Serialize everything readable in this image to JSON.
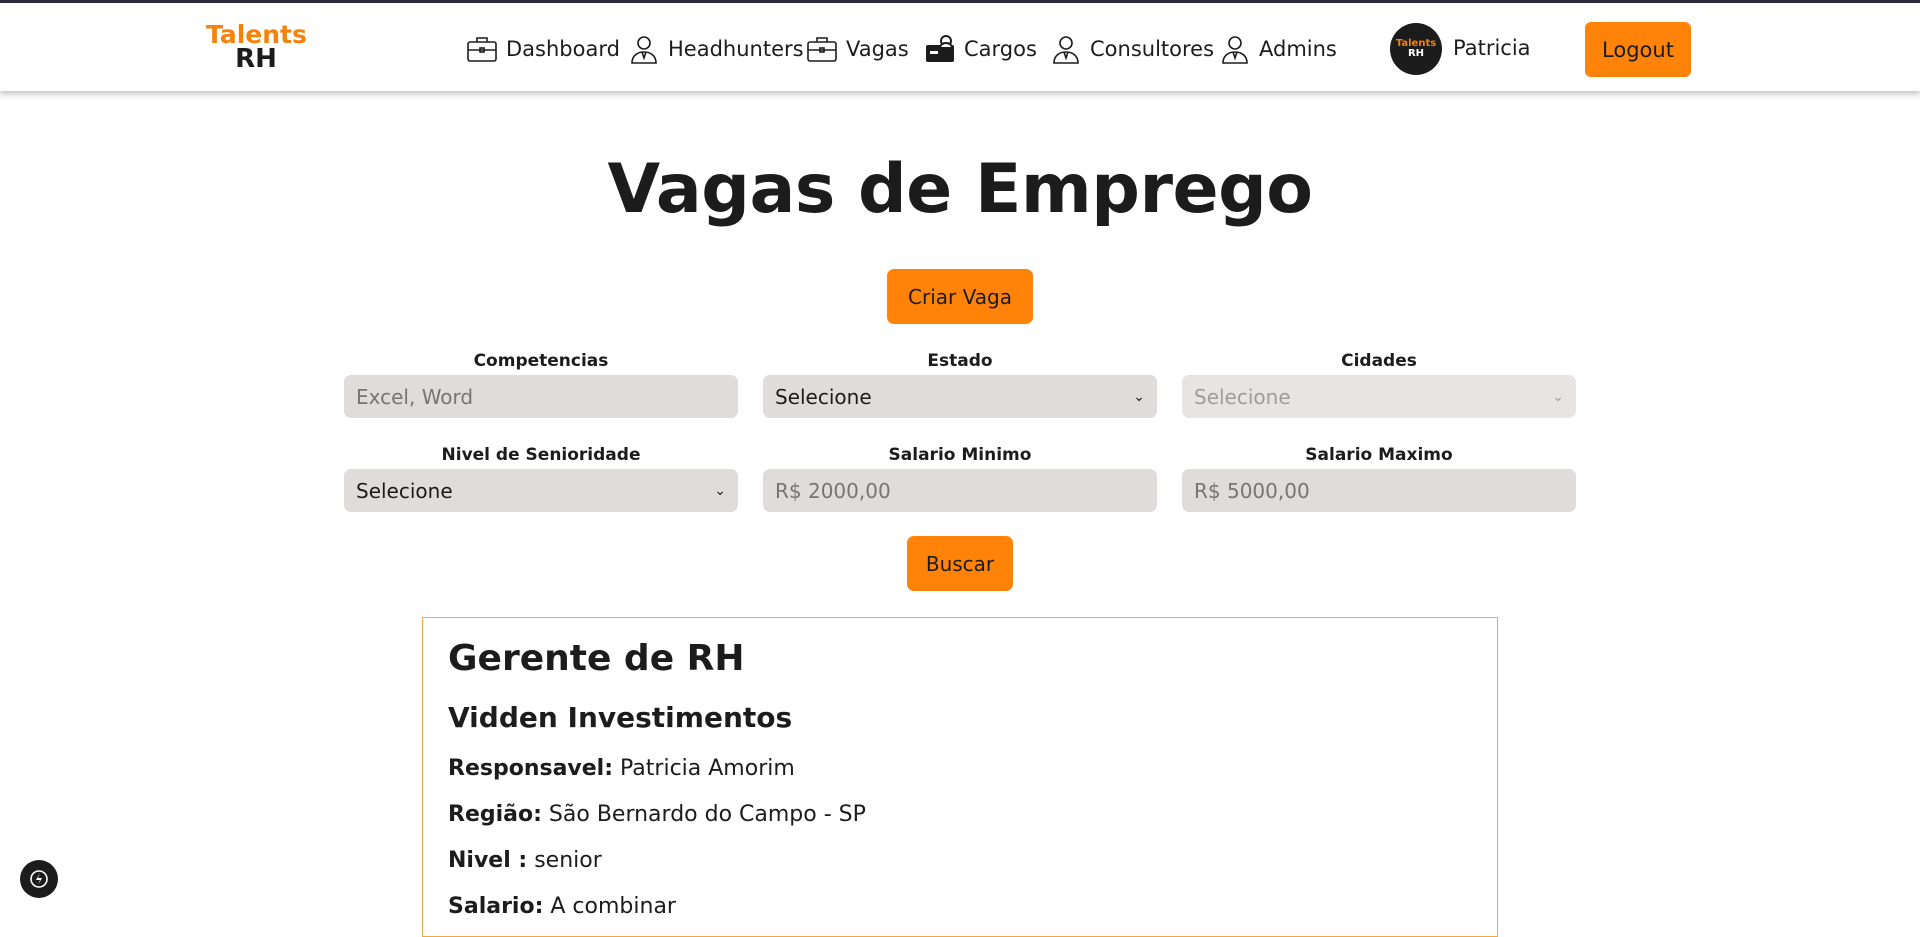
{
  "brand": {
    "logo_line1": "Talents",
    "logo_line2": "RH",
    "avatar_line1": "Talents",
    "avatar_line2": "RH"
  },
  "nav": {
    "items": [
      {
        "label": "Dashboard",
        "icon": "briefcase-icon"
      },
      {
        "label": "Headhunters",
        "icon": "person-icon"
      },
      {
        "label": "Vagas",
        "icon": "briefcase-icon"
      },
      {
        "label": "Cargos",
        "icon": "briefcase-user-icon"
      },
      {
        "label": "Consultores",
        "icon": "person-icon"
      },
      {
        "label": "Admins",
        "icon": "person-icon"
      }
    ],
    "user_name": "Patricia",
    "logout_label": "Logout"
  },
  "page": {
    "title": "Vagas de Emprego",
    "create_label": "Criar Vaga",
    "search_label": "Buscar"
  },
  "filters": {
    "competencias": {
      "label": "Competencias",
      "placeholder": "Excel, Word"
    },
    "estado": {
      "label": "Estado",
      "value": "Selecione"
    },
    "cidades": {
      "label": "Cidades",
      "value": "Selecione"
    },
    "nivel": {
      "label": "Nivel de Senioridade",
      "value": "Selecione"
    },
    "salario_min": {
      "label": "Salario Minimo",
      "placeholder": "R$ 2000,00"
    },
    "salario_max": {
      "label": "Salario Maximo",
      "placeholder": "R$ 5000,00"
    }
  },
  "job": {
    "title": "Gerente de RH",
    "company": "Vidden Investimentos",
    "responsavel_label": "Responsavel:",
    "responsavel": "Patricia Amorim",
    "regiao_label": "Região:",
    "regiao": "São Bernardo do Campo - SP",
    "nivel_label": "Nivel :",
    "nivel": "senior",
    "salario_label": "Salario:",
    "salario": "A combinar"
  },
  "colors": {
    "accent": "#ff8209",
    "field_bg": "#e1dcdc",
    "text": "#1c1c1c",
    "card_border": "#f5a840"
  }
}
